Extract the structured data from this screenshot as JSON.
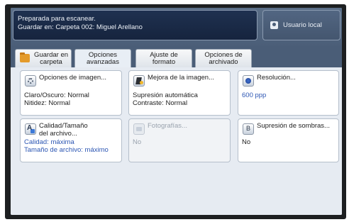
{
  "status": {
    "line1": "Preparada para escanear.",
    "line2": "Guardar en: Carpeta 002: Miguel Arellano"
  },
  "user_button": {
    "label": "Usuario local",
    "icon": "user-icon"
  },
  "tabs": [
    {
      "line1": "Guardar en",
      "line2": "carpeta",
      "icon": "folder-icon",
      "active": false
    },
    {
      "line1": "Opciones",
      "line2": "avanzadas",
      "active": true
    },
    {
      "line1": "Ajuste de",
      "line2": "formato",
      "active": false
    },
    {
      "line1": "Opciones de",
      "line2": "archivado",
      "active": false
    }
  ],
  "cards": {
    "image_options": {
      "title": "Opciones de imagen...",
      "line1": "Claro/Oscuro: Normal",
      "line2": "Nitidez: Normal",
      "icon": "image-options-icon"
    },
    "image_enhancement": {
      "title": "Mejora de la imagen...",
      "line1": "Supresión automática",
      "line2": "Contraste: Normal",
      "icon": "image-enhancement-icon"
    },
    "resolution": {
      "title": "Resolución...",
      "value": "600 ppp",
      "icon": "resolution-icon"
    },
    "quality_size": {
      "title_line1": "Calidad/Tamaño",
      "title_line2": "del archivo...",
      "line1": "Calidad: máxima",
      "line2": "Tamaño de archivo: máximo",
      "icon": "quality-size-icon"
    },
    "photographs": {
      "title": "Fotografías...",
      "value": "No",
      "disabled": true,
      "icon": "photo-icon"
    },
    "shadow_suppression": {
      "title": "Supresión de sombras...",
      "value": "No",
      "icon": "shadow-suppression-icon"
    }
  },
  "colors": {
    "status_bg": "#1f3150",
    "tab_bar": "#4a5d77",
    "content_bg": "#e6ebf2",
    "value_blue": "#2c56b3"
  }
}
